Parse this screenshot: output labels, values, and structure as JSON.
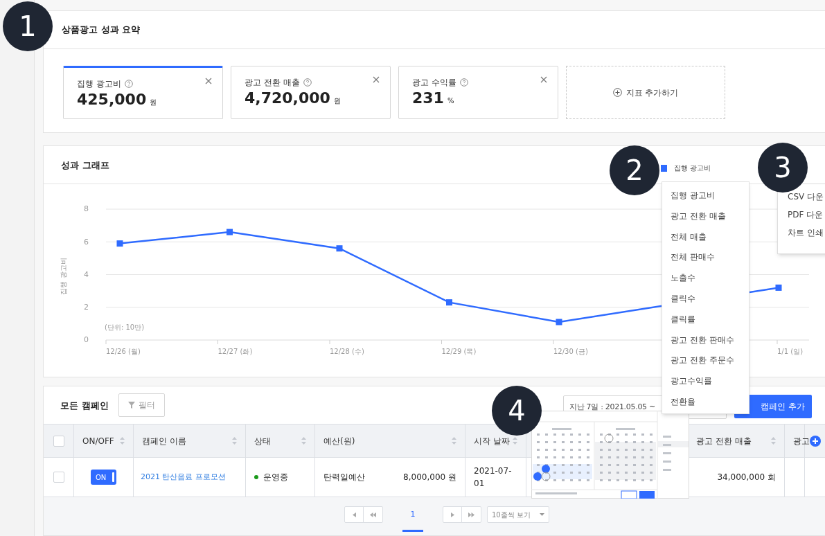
{
  "badges": [
    {
      "label": "1",
      "kind": "top"
    },
    {
      "label": "2",
      "kind": "legend"
    },
    {
      "label": "3",
      "kind": "export"
    },
    {
      "label": "4",
      "kind": "date"
    }
  ],
  "summary": {
    "title": "상품광고 성과 요약",
    "cards": [
      {
        "label": "집행 광고비",
        "value": "425,000",
        "unit": "원",
        "selected": true
      },
      {
        "label": "광고 전환 매출",
        "value": "4,720,000",
        "unit": "원",
        "selected": false
      },
      {
        "label": "광고 수익률",
        "value": "231",
        "unit": "%",
        "selected": false
      }
    ],
    "add_label": "지표 추가하기"
  },
  "graph": {
    "title": "성과 그래프",
    "unit_note": "(단위: 10만)",
    "chart_data": {
      "type": "line",
      "ylabel": "집행 광고비",
      "categories": [
        "12/26 (월)",
        "12/27 (화)",
        "12/28 (수)",
        "12/29 (목)",
        "12/30 (금)",
        null,
        "1/1 (일)"
      ],
      "yticks": [
        0,
        2,
        4,
        6,
        8
      ],
      "ylim": [
        0,
        8
      ],
      "grid": true,
      "series": [
        {
          "name": "집행 광고비",
          "color": "#2f6bff",
          "marker": "square",
          "values": [
            5.9,
            6.6,
            5.6,
            2.3,
            1.1,
            null,
            3.2
          ]
        }
      ]
    },
    "metric_menu": [
      "집행 광고비",
      "광고 전환 매출",
      "전체 매출",
      "전체 판매수",
      "노출수",
      "클릭수",
      "클릭률",
      "광고 전환 판매수",
      "광고 전환 주문수",
      "광고수익률",
      "전환율"
    ],
    "export_menu": [
      "CSV 다운",
      "PDF 다운",
      "차트 인쇄"
    ]
  },
  "campaigns": {
    "title": "모든 캠페인",
    "filter": "필터",
    "date_range": "지난 7일 : 2021.05.05 ~",
    "add_button": "캠페인 추가",
    "all_checked": false,
    "columns": [
      {
        "label": "ON/OFF",
        "kind": "sort"
      },
      {
        "label": "캠페인 이름",
        "kind": "sort"
      },
      {
        "label": "상태",
        "kind": "sort"
      },
      {
        "label": "예산(원)",
        "kind": "sort"
      },
      {
        "label": "시작 날짜",
        "kind": "sort"
      },
      {
        "kind": "hidden"
      },
      {
        "label": "광고 전환 매출",
        "kind": "sort"
      },
      {
        "label": "광고",
        "kind": "cut"
      }
    ],
    "rows": [
      {
        "checked": false,
        "on": true,
        "on_label": "ON",
        "name": "2021 탄산음료 프로모션",
        "status": "운영중",
        "color": "#1a9a1a",
        "budget_type": "탄력일예산",
        "budget": "8,000,000 원",
        "start": "2021-07-01",
        "sales": "34,000,000 회"
      }
    ],
    "pagination": {
      "pages": [
        {
          "label": "1",
          "selected": true
        }
      ],
      "page_size": "10줄씩 보기"
    }
  }
}
